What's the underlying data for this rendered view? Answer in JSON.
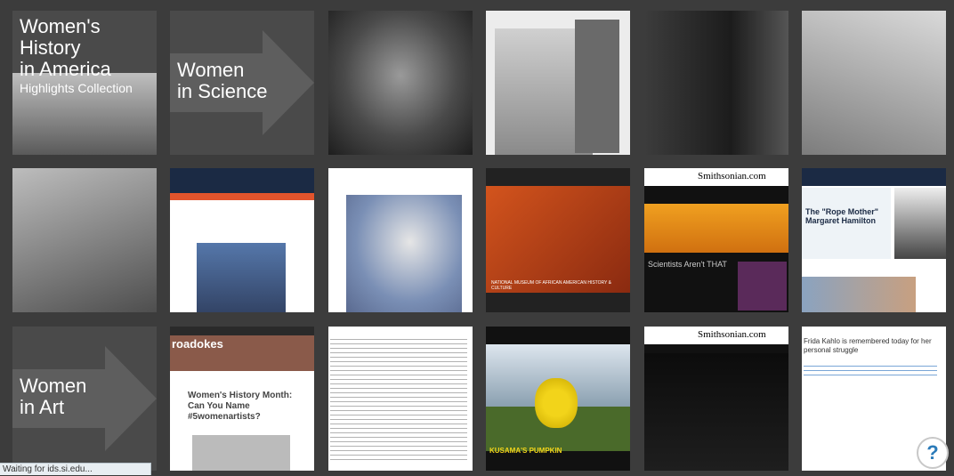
{
  "tiles": {
    "womens_history": {
      "lines": [
        "Women's",
        "History",
        "in America"
      ],
      "sub": "Highlights Collection"
    },
    "women_in_science": {
      "lines": [
        "Women",
        "in Science"
      ]
    },
    "women_in_art": {
      "lines": [
        "Women",
        "in Art"
      ]
    }
  },
  "web_tiles": {
    "smithsonian_logo_1": "Smithsonian.com",
    "smithsonian_logo_2": "Smithsonian.com",
    "rope_mother_title": "The \"Rope Mother\" Margaret Hamilton",
    "womens_history_month_title": "Women's History Month: Can You Name #5womenartists?",
    "broadstrokes_banner": "roadokes",
    "scientists_caption": "Scientists Aren't THAT",
    "kusama_caption": "KUSAMA'S PUMPKIN",
    "nmaahc_caption": "NATIONAL MUSEUM OF AFRICAN AMERICAN HISTORY & CULTURE",
    "frida_text": "Frida Kahlo is remembered today for her personal struggle"
  },
  "status": {
    "text": "Waiting for ids.si.edu..."
  },
  "help": {
    "label": "?"
  },
  "colors": {
    "background": "#3c3c3c",
    "help_accent": "#2b7bb9"
  }
}
